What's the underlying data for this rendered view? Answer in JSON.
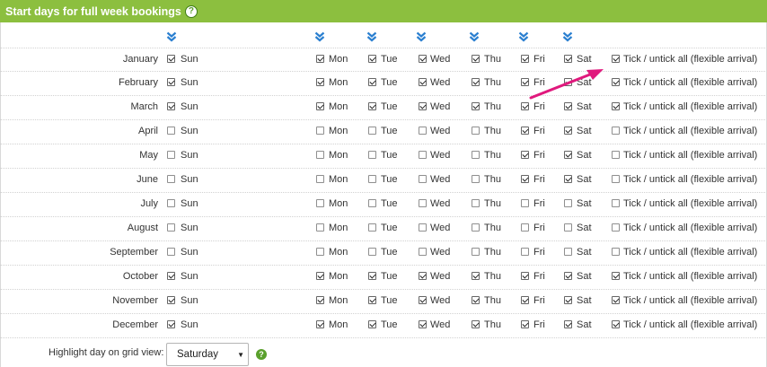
{
  "header": {
    "title": "Start days for full week bookings",
    "help_icon": "?"
  },
  "days": [
    "Sun",
    "Mon",
    "Tue",
    "Wed",
    "Thu",
    "Fri",
    "Sat"
  ],
  "tick_all_label": "Tick / untick all (flexible arrival)",
  "months": [
    {
      "name": "January",
      "checked": [
        true,
        true,
        true,
        true,
        true,
        true,
        true
      ],
      "tick_all": true
    },
    {
      "name": "February",
      "checked": [
        true,
        true,
        true,
        true,
        true,
        true,
        true
      ],
      "tick_all": true
    },
    {
      "name": "March",
      "checked": [
        true,
        true,
        true,
        true,
        true,
        true,
        true
      ],
      "tick_all": true
    },
    {
      "name": "April",
      "checked": [
        false,
        false,
        false,
        false,
        false,
        true,
        true
      ],
      "tick_all": false
    },
    {
      "name": "May",
      "checked": [
        false,
        false,
        false,
        false,
        false,
        true,
        true
      ],
      "tick_all": false
    },
    {
      "name": "June",
      "checked": [
        false,
        false,
        false,
        false,
        false,
        true,
        true
      ],
      "tick_all": false
    },
    {
      "name": "July",
      "checked": [
        false,
        false,
        false,
        false,
        false,
        false,
        false
      ],
      "tick_all": false
    },
    {
      "name": "August",
      "checked": [
        false,
        false,
        false,
        false,
        false,
        false,
        false
      ],
      "tick_all": false
    },
    {
      "name": "September",
      "checked": [
        false,
        false,
        false,
        false,
        false,
        false,
        false
      ],
      "tick_all": false
    },
    {
      "name": "October",
      "checked": [
        true,
        true,
        true,
        true,
        true,
        true,
        true
      ],
      "tick_all": true
    },
    {
      "name": "November",
      "checked": [
        true,
        true,
        true,
        true,
        true,
        true,
        true
      ],
      "tick_all": true
    },
    {
      "name": "December",
      "checked": [
        true,
        true,
        true,
        true,
        true,
        true,
        true
      ],
      "tick_all": true
    }
  ],
  "bottom": {
    "label": "Highlight day on grid view:",
    "select_value": "Saturday",
    "help_icon": "?"
  },
  "colors": {
    "header_bg": "#8cbf3f",
    "chevron": "#2a7fd0",
    "annotation_arrow": "#e0197d"
  },
  "icons": {
    "column_toggle": "double-chevron-down-icon",
    "annotation": "arrow-annotation-icon"
  }
}
